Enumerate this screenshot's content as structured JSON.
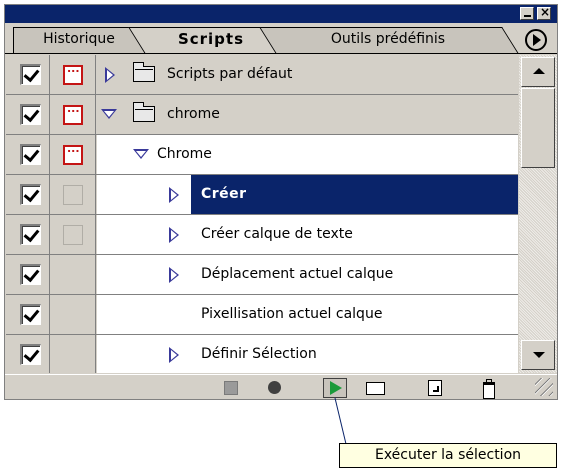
{
  "window": {
    "minimize_icon": "minimize-icon",
    "close_icon": "close-icon"
  },
  "tabs": [
    {
      "label": "Historique",
      "active": false
    },
    {
      "label": "Scripts",
      "active": true
    },
    {
      "label": "Outils prédéfinis",
      "active": false
    }
  ],
  "rows": [
    {
      "label": "Scripts par défaut",
      "checked": true,
      "dialog": true,
      "disclosure": "collapsed",
      "kind": "set"
    },
    {
      "label": "chrome",
      "checked": true,
      "dialog": true,
      "disclosure": "expanded",
      "kind": "set"
    },
    {
      "label": "Chrome",
      "checked": true,
      "dialog": true,
      "disclosure": "expanded",
      "kind": "action"
    },
    {
      "label": "Créer",
      "checked": true,
      "dialog": false,
      "disclosure": "collapsed",
      "kind": "command",
      "selected": true
    },
    {
      "label": "Créer calque de texte",
      "checked": true,
      "dialog": false,
      "disclosure": "collapsed",
      "kind": "command"
    },
    {
      "label": "Déplacement actuel calque",
      "checked": true,
      "dialog": false,
      "disclosure": "collapsed",
      "kind": "command"
    },
    {
      "label": "Pixellisation actuel calque",
      "checked": true,
      "dialog": false,
      "disclosure": "none",
      "kind": "command"
    },
    {
      "label": "Définir Sélection",
      "checked": true,
      "dialog": false,
      "disclosure": "collapsed",
      "kind": "command"
    }
  ],
  "toolbar": {
    "items": [
      "stop-icon",
      "record-icon",
      "play-icon",
      "new-set-icon",
      "new-action-icon",
      "trash-icon"
    ]
  },
  "tooltip": {
    "text": "Exécuter la sélection"
  },
  "colors": {
    "titlebar": "#0a246a",
    "selection": "#0a246a",
    "panel": "#d4d0c8",
    "dialog_toggle": "#c41414",
    "play": "#1a9a3a",
    "tooltip_bg": "#ffffe1"
  }
}
